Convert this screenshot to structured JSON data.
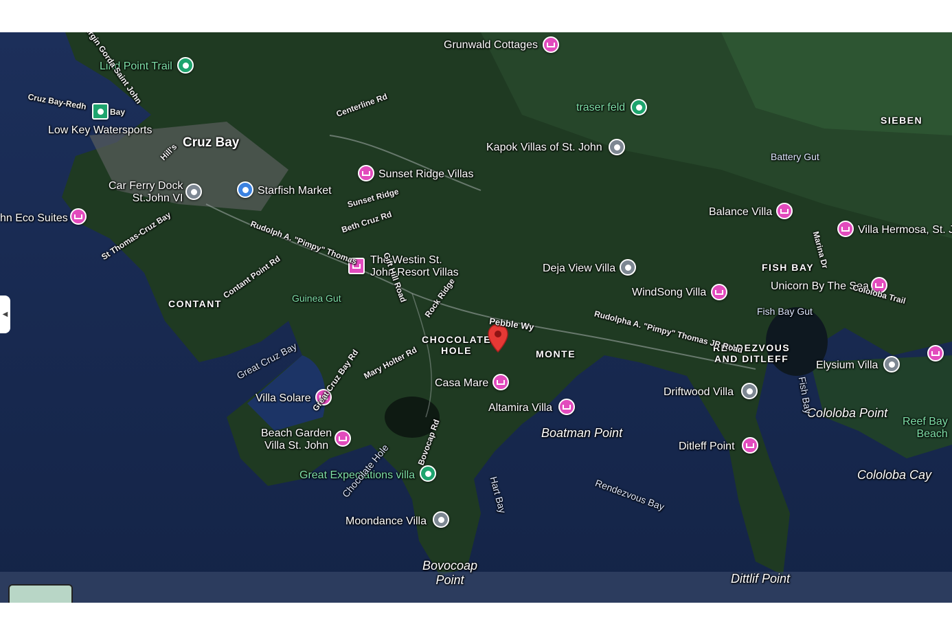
{
  "map": {
    "selected_pin_label": "Pebble Wy",
    "places": [
      {
        "name": "Grunwald Cottages",
        "icon": "hotel-icon"
      },
      {
        "name": "Lind Point Trail",
        "icon": "hiking-icon"
      },
      {
        "name": "Low Key Watersports",
        "icon": "place-icon"
      },
      {
        "name": "Cruz Bay",
        "icon": "none"
      },
      {
        "name": "Car Ferry Dock\nSt.John VI",
        "icon": "place-icon"
      },
      {
        "name": "Starfish Market",
        "icon": "shopping-cart-icon"
      },
      {
        "name": "hn Eco Suites",
        "icon": "hotel-icon"
      },
      {
        "name": "Sunset Ridge Villas",
        "icon": "hotel-icon"
      },
      {
        "name": "traser feld",
        "icon": "tree-icon"
      },
      {
        "name": "Kapok Villas of St. John",
        "icon": "place-icon"
      },
      {
        "name": "Balance Villa",
        "icon": "hotel-icon"
      },
      {
        "name": "Villa Hermosa, St. J",
        "icon": "hotel-icon"
      },
      {
        "name": "The Westin St.\nJohn Resort Villas",
        "icon": "hotel-icon"
      },
      {
        "name": "Deja View Villa",
        "icon": "place-icon"
      },
      {
        "name": "WindSong Villa",
        "icon": "hotel-icon"
      },
      {
        "name": "Unicorn By The Sea",
        "icon": "hotel-icon"
      },
      {
        "name": "Guinea Gut",
        "icon": "none"
      },
      {
        "name": "Casa Mare",
        "icon": "hotel-icon"
      },
      {
        "name": "Altamira Villa",
        "icon": "hotel-icon"
      },
      {
        "name": "Elysium Villa",
        "icon": "place-icon"
      },
      {
        "name": "Driftwood Villa",
        "icon": "place-icon"
      },
      {
        "name": "Villa Solare",
        "icon": "hotel-icon"
      },
      {
        "name": "Beach Garden\nVilla St. John",
        "icon": "hotel-icon"
      },
      {
        "name": "Great Expectations villa",
        "icon": "place-icon"
      },
      {
        "name": "Ditleff Point",
        "icon": "hotel-icon"
      },
      {
        "name": "Moondance Villa",
        "icon": "place-icon"
      }
    ],
    "areas": [
      "CONTANT",
      "CHOCOLATE\nHOLE",
      "MONTE",
      "RENDEZVOUS\nAND DITLEFF",
      "FISH BAY",
      "SIEBEN"
    ],
    "water": [
      "Great Cruz Bay",
      "Chocolate Hole",
      "Hart Bay",
      "Rendezvous Bay",
      "Boatman Point",
      "Bovocoap\nPoint",
      "Dittlif Point",
      "Cololoba Point",
      "Cololoba Cay",
      "Reef Bay\nBeach",
      "Fish Bay",
      "Fish Bay Gut",
      "Battery Gut",
      "Cruz Bay-Redh",
      "Bay"
    ],
    "roads": [
      "Centerline Rd",
      "Sunset Ridge",
      "Beth Cruz Rd",
      "Rudolph A. \"Pimpy\" Thomas",
      "Contant Point Rd",
      "Rock Ridge",
      "Mary Holter Rd",
      "Gift Hill Road",
      "Great Cruz Bay Rd",
      "Bovocap Rd",
      "Rudolpha A. \"Pimpy\" Thomas JR Road",
      "Marina Dr",
      "Cololoba Trail",
      "St Thomas-Cruz Bay",
      "Hill's",
      "Virgin Gorda Saint John"
    ],
    "colors": {
      "hotel": "#e24bbd",
      "place": "#7d8792",
      "park": "#1ea46e",
      "shop": "#3b82e0",
      "selected": "#e53935"
    }
  }
}
